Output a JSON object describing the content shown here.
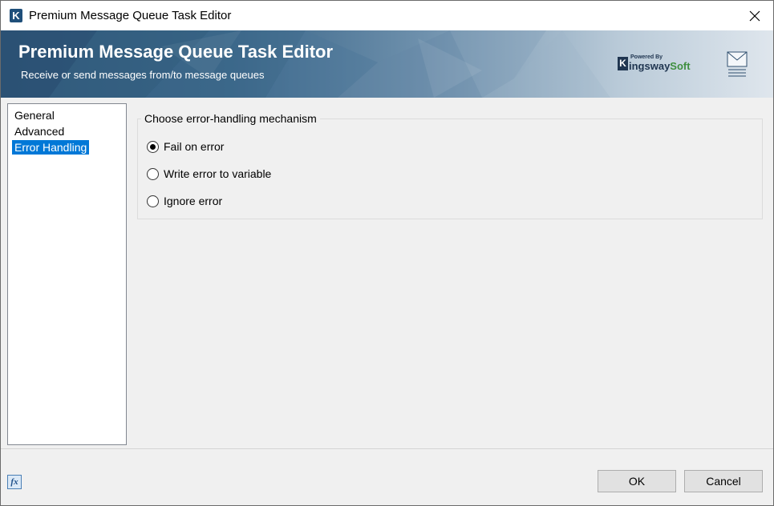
{
  "window": {
    "title": "Premium Message Queue Task Editor",
    "app_icon": "kingswaysoft-k-icon",
    "close_icon": "close-icon"
  },
  "banner": {
    "title": "Premium Message Queue Task Editor",
    "subtitle": "Receive or send messages from/to message queues",
    "logo": {
      "powered_by": "Powered By",
      "letter": "K",
      "name_part1": "ingsway",
      "name_part2": "Soft"
    },
    "icon": "envelope-stack-icon"
  },
  "nav": {
    "items": [
      {
        "label": "General",
        "selected": false
      },
      {
        "label": "Advanced",
        "selected": false
      },
      {
        "label": "Error Handling",
        "selected": true
      }
    ]
  },
  "error_handling": {
    "group_title": "Choose error-handling mechanism",
    "options": [
      {
        "label": "Fail on error",
        "checked": true
      },
      {
        "label": "Write error to variable",
        "checked": false
      },
      {
        "label": "Ignore error",
        "checked": false
      }
    ]
  },
  "footer": {
    "fx_label": "fx",
    "ok_label": "OK",
    "cancel_label": "Cancel"
  },
  "colors": {
    "selection": "#0078d7",
    "banner_dark": "#2e5578",
    "logo_green": "#3f8f3f"
  }
}
